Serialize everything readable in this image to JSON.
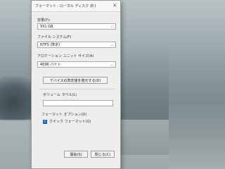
{
  "dialog": {
    "title": "フォーマット - ローカル ディスク (E:)",
    "close_glyph": "✕"
  },
  "capacity": {
    "label": "容量(P):",
    "value": "931 GB"
  },
  "filesystem": {
    "label": "ファイル システム(F)",
    "value": "NTFS (既定)"
  },
  "allocation": {
    "label": "アロケーション ユニット サイズ(A)",
    "value": "4096 バイト"
  },
  "restore_defaults_label": "デバイスの既定値を復元する(D)",
  "volume": {
    "label": "ボリューム ラベル(L)",
    "value": ""
  },
  "format_options": {
    "label": "フォーマット オプション(O)",
    "quick_format_label": "クイック フォーマット(Q)",
    "quick_format_checked": true
  },
  "buttons": {
    "start": "開始(S)",
    "close": "閉じる(C)"
  },
  "icons": {
    "chevron": "chevron-down-icon",
    "close": "close-icon",
    "check": "checkmark-icon"
  }
}
